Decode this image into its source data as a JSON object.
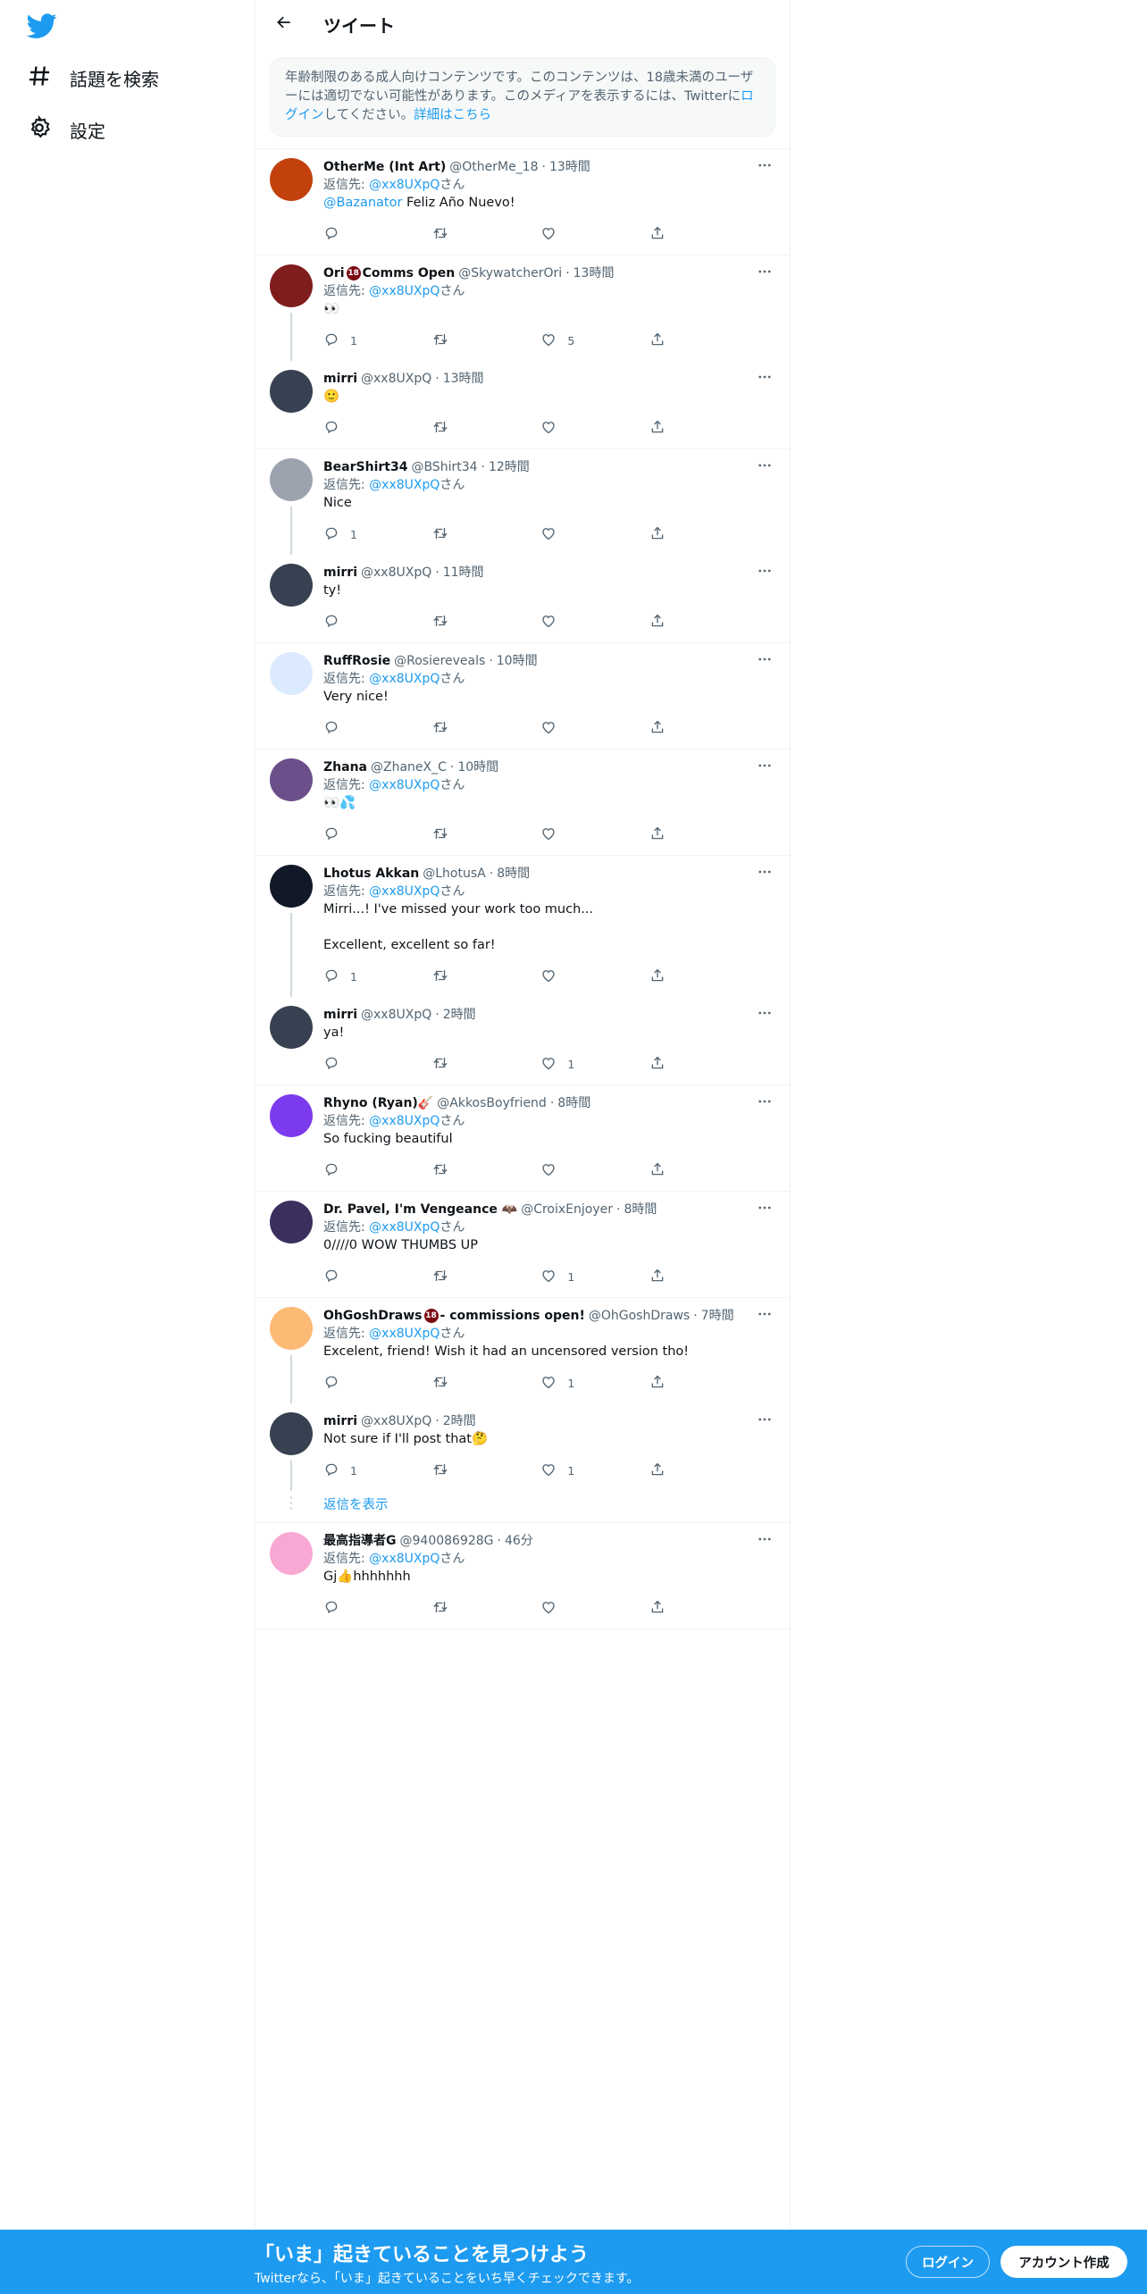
{
  "sidebar": {
    "logo": "twitter-bird-icon",
    "items": [
      {
        "label": "話題を検索",
        "icon": "hashtag-icon"
      },
      {
        "label": "設定",
        "icon": "gear-icon"
      }
    ]
  },
  "header": {
    "title": "ツイート",
    "back_icon": "arrow-left-icon"
  },
  "notice": {
    "text_1": "年齢制限のある成人向けコンテンツです。このコンテンツは、18歳未満のユーザーには適切でない可能性があります。このメディアを表示するには、Twitterに",
    "login_link": "ログイン",
    "text_2": "してください。",
    "details_link": "詳細はこちら"
  },
  "labels": {
    "reply_prefix": "返信先: ",
    "reply_suffix": "さん",
    "show_replies": "返信を表示"
  },
  "colors": {
    "accent": "#1d9bf0",
    "secondary_text": "#536471",
    "divider": "#eff3f4"
  },
  "threads": [
    {
      "tweets": [
        {
          "name": "OtherMe (Int Art)",
          "handle": "@OtherMe_18",
          "time": "13時間",
          "reply_to": "@xx8UXpQ",
          "mention": "@Bazanator",
          "text": " Feliz Año Nuevo!",
          "replies": "",
          "retweets": "",
          "likes": ""
        }
      ]
    },
    {
      "tweets": [
        {
          "name": "Ori",
          "name_after_badge": " Comms Open",
          "handle": "@SkywatcherOri",
          "time": "13時間",
          "reply_to": "@xx8UXpQ",
          "text": "👀",
          "replies": "1",
          "retweets": "",
          "likes": "5"
        },
        {
          "name": "mirri",
          "handle": "@xx8UXpQ",
          "time": "13時間",
          "text": "🙂",
          "replies": "",
          "retweets": "",
          "likes": ""
        }
      ]
    },
    {
      "tweets": [
        {
          "name": "BearShirt34",
          "handle": "@BShirt34",
          "time": "12時間",
          "reply_to": "@xx8UXpQ",
          "text": "Nice",
          "replies": "1",
          "retweets": "",
          "likes": ""
        },
        {
          "name": "mirri",
          "handle": "@xx8UXpQ",
          "time": "11時間",
          "text": "ty!",
          "replies": "",
          "retweets": "",
          "likes": ""
        }
      ]
    },
    {
      "tweets": [
        {
          "name": "RuffRosie",
          "handle": "@Rosiereveals",
          "time": "10時間",
          "reply_to": "@xx8UXpQ",
          "text": "Very nice!",
          "replies": "",
          "retweets": "",
          "likes": ""
        }
      ]
    },
    {
      "tweets": [
        {
          "name": "Zhana",
          "handle": "@ZhaneX_C",
          "time": "10時間",
          "reply_to": "@xx8UXpQ",
          "text": "👀💦",
          "replies": "",
          "retweets": "",
          "likes": ""
        }
      ]
    },
    {
      "tweets": [
        {
          "name": "Lhotus Akkan",
          "handle": "@LhotusA",
          "time": "8時間",
          "reply_to": "@xx8UXpQ",
          "text": "Mirri...! I've missed your work too much...\n\nExcellent, excellent so far!",
          "replies": "1",
          "retweets": "",
          "likes": ""
        },
        {
          "name": "mirri",
          "handle": "@xx8UXpQ",
          "time": "2時間",
          "text": "ya!",
          "replies": "",
          "retweets": "",
          "likes": "1"
        }
      ]
    },
    {
      "tweets": [
        {
          "name": "Rhyno (Ryan)🎸",
          "handle": "@AkkosBoyfriend",
          "time": "8時間",
          "reply_to": "@xx8UXpQ",
          "text": "So fucking beautiful",
          "replies": "",
          "retweets": "",
          "likes": ""
        }
      ]
    },
    {
      "tweets": [
        {
          "name": "Dr. Pavel, I'm Vengeance 🦇",
          "handle": "@CroixEnjoyer",
          "time": "8時間",
          "reply_to": "@xx8UXpQ",
          "text": "0////0 WOW THUMBS UP",
          "replies": "",
          "retweets": "",
          "likes": "1"
        }
      ]
    },
    {
      "tweets": [
        {
          "name": "OhGoshDraws",
          "name_after_badge": " - commissions open!",
          "handle": "@OhGoshDraws",
          "time": "7時間",
          "reply_to": "@xx8UXpQ",
          "text": "Excelent, friend! Wish it had an uncensored version tho!",
          "replies": "",
          "retweets": "",
          "likes": "1"
        },
        {
          "name": "mirri",
          "handle": "@xx8UXpQ",
          "time": "2時間",
          "text": "Not sure if I'll post that🤔",
          "replies": "1",
          "retweets": "",
          "likes": "1"
        }
      ],
      "show_replies": true
    },
    {
      "tweets": [
        {
          "name": "最高指導者G",
          "handle": "@940086928G",
          "time": "46分",
          "reply_to": "@xx8UXpQ",
          "text": "Gj👍hhhhhhh",
          "replies": "",
          "retweets": "",
          "likes": ""
        }
      ]
    }
  ],
  "banner": {
    "title": "「いま」起きていることを見つけよう",
    "subtitle": "Twitterなら、「いま」起きていることをいち早くチェックできます。",
    "login": "ログイン",
    "signup": "アカウント作成"
  }
}
